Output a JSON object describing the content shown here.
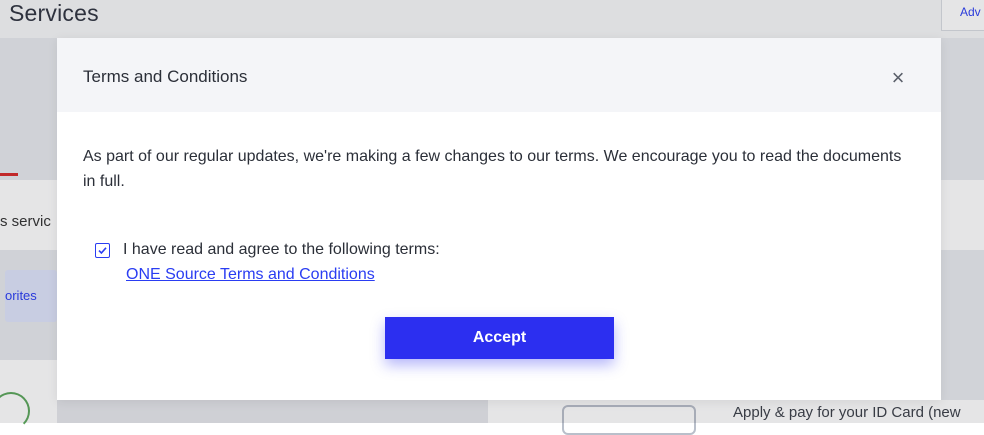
{
  "background": {
    "page_title": "Services",
    "adv_label": "Adv",
    "left_services_text": "s servic",
    "left_favorites_text": "orites",
    "apply_text": "Apply & pay for your ID Card (new"
  },
  "modal": {
    "title": "Terms and Conditions",
    "close_icon": "×",
    "body": "As part of our regular updates, we're making a few changes to our terms. We encourage you to read the documents in full.",
    "agree_checked": true,
    "agree_label": "I have read and agree to the following terms:",
    "terms_link": "ONE Source Terms and Conditions",
    "accept_label": "Accept"
  },
  "colors": {
    "accent": "#2c2ff0",
    "link": "#2a3df2",
    "header_bg": "#f4f5f8"
  }
}
